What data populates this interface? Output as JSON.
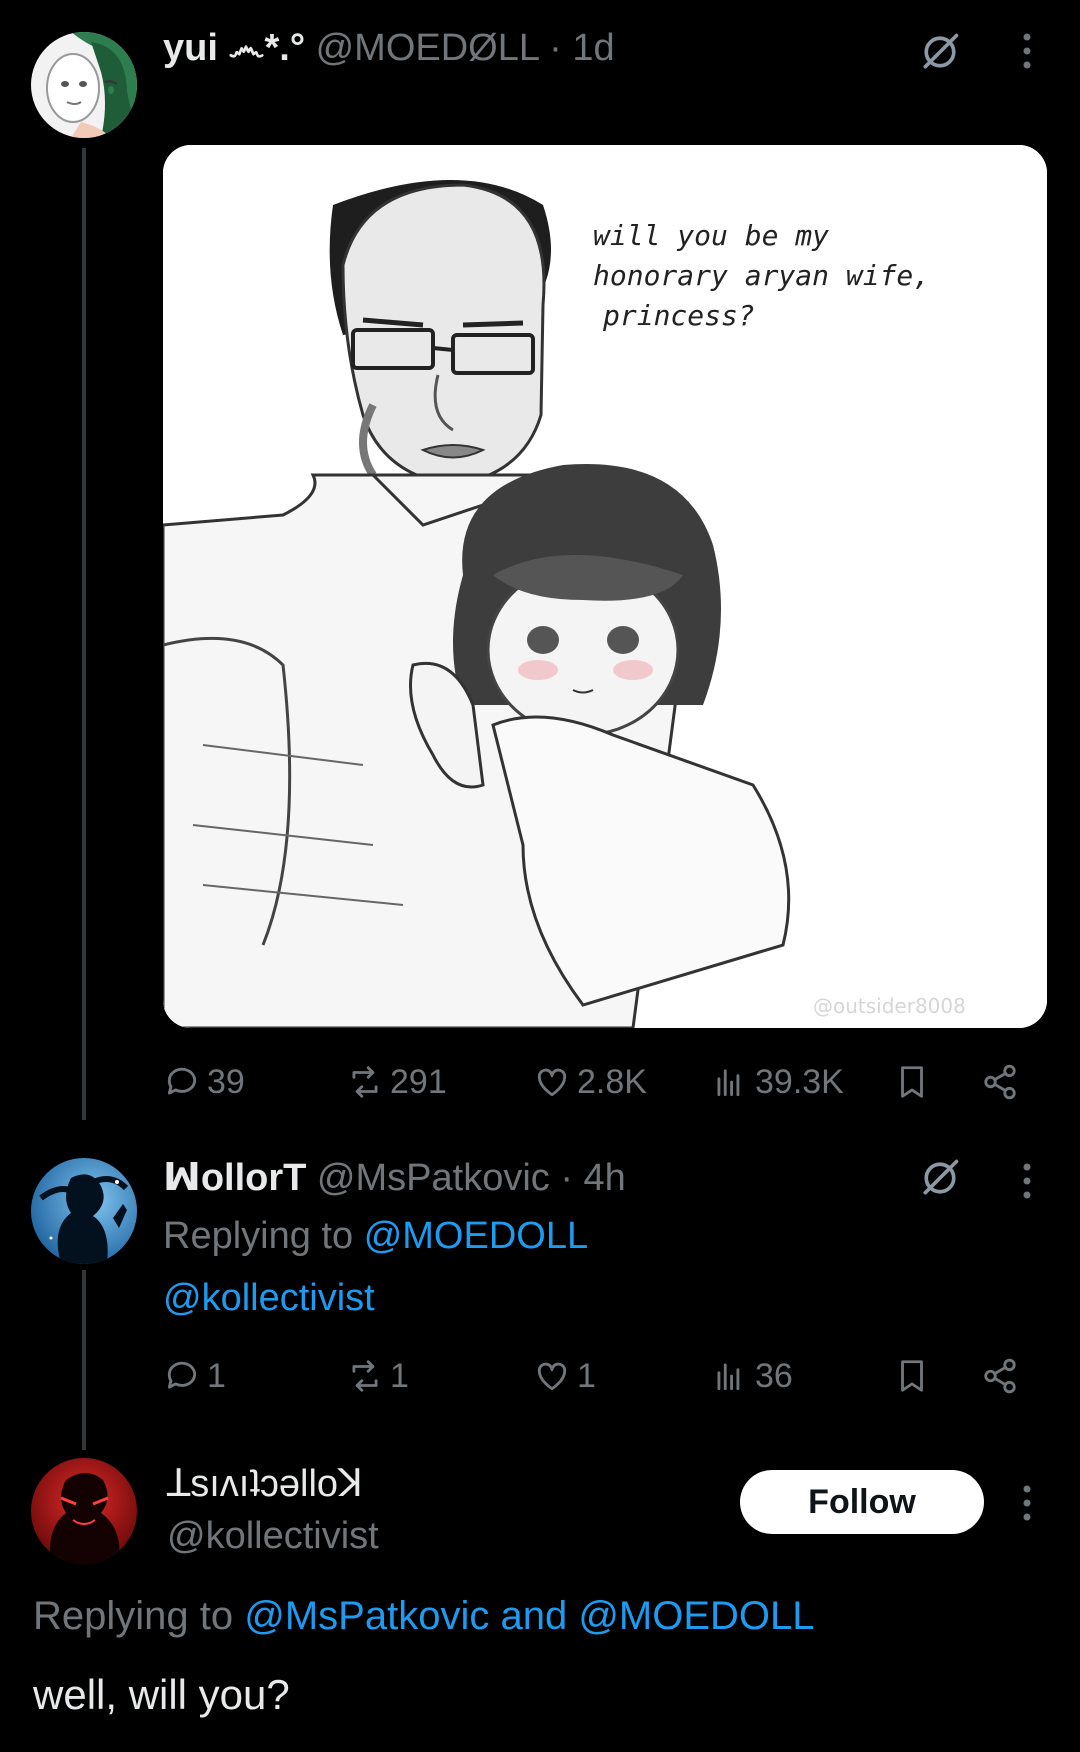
{
  "post1": {
    "display_name": "yui ෴*.°",
    "handle": "@MOEDØLL",
    "time": "· 1d",
    "image_text": "will you be my honorary aryan wife, princess?",
    "watermark": "@outsider8008",
    "stats": {
      "replies": "39",
      "reposts": "291",
      "likes": "2.8K",
      "views": "39.3K"
    }
  },
  "post2": {
    "display_name": "ꟽollorT",
    "handle": "@MsPatkovic",
    "time": "· 4h",
    "replying_prefix": "Replying to",
    "replying_to": "@MOEDOLL",
    "text": "@kollectivist",
    "stats": {
      "replies": "1",
      "reposts": "1",
      "likes": "1",
      "views": "36"
    }
  },
  "post3": {
    "display_name": "ꓕsıʌıʇɔəlloꓘ",
    "handle": "@kollectivist",
    "follow_label": "Follow",
    "replying_prefix": "Replying to",
    "replying_to": "@MsPatkovic and @MOEDOLL",
    "text": "well, will you?"
  },
  "colors": {
    "background": "#000000",
    "text": "#e7e9ea",
    "muted": "#71767b",
    "link": "#1d9bf0"
  }
}
